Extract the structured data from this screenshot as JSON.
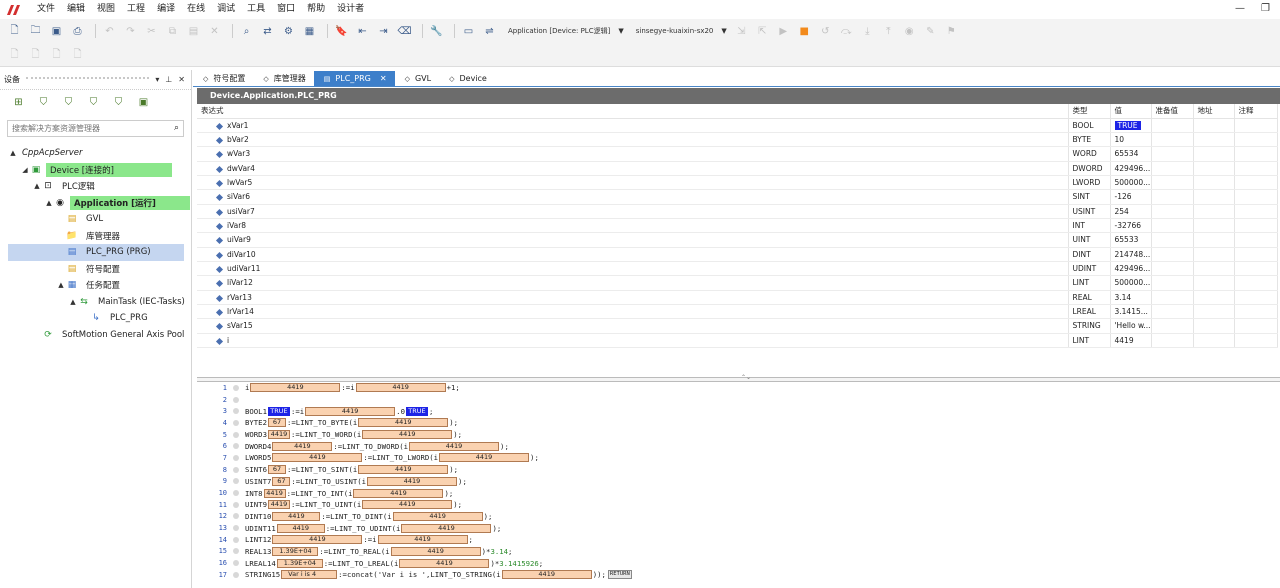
{
  "menu": [
    "文件",
    "编辑",
    "视图",
    "工程",
    "编译",
    "在线",
    "调试",
    "工具",
    "窗口",
    "帮助",
    "设计者"
  ],
  "toolbar": {
    "application_dropdown": "Application [Device: PLC逻辑]",
    "device_dropdown": "sinsegye-kuaixin-sx20"
  },
  "side_panel": {
    "title": "设备",
    "search_placeholder": "搜索解决方案资源管理器",
    "tree": [
      {
        "label": "CppAcpServer",
        "level": 0,
        "icon": "project-icon",
        "expander": "▲"
      },
      {
        "label": "Device [连接的]",
        "level": 1,
        "icon": "device-icon",
        "expander": "◢",
        "highlight": "green"
      },
      {
        "label": "PLC逻辑",
        "level": 2,
        "icon": "plc-logic-icon",
        "expander": "▲"
      },
      {
        "label": "Application [运行]",
        "level": 3,
        "icon": "application-icon",
        "expander": "▲",
        "highlight": "green",
        "bold": true
      },
      {
        "label": "GVL",
        "level": 4,
        "icon": "gvl-icon",
        "expander": ""
      },
      {
        "label": "库管理器",
        "level": 4,
        "icon": "library-icon",
        "expander": ""
      },
      {
        "label": "PLC_PRG (PRG)",
        "level": 4,
        "icon": "program-icon",
        "expander": "",
        "selected": true
      },
      {
        "label": "符号配置",
        "level": 4,
        "icon": "symbol-config-icon",
        "expander": ""
      },
      {
        "label": "任务配置",
        "level": 4,
        "icon": "task-config-icon",
        "expander": "▲"
      },
      {
        "label": "MainTask (IEC-Tasks)",
        "level": 5,
        "icon": "task-icon",
        "expander": "▲"
      },
      {
        "label": "PLC_PRG",
        "level": 6,
        "icon": "call-icon",
        "expander": ""
      },
      {
        "label": "SoftMotion General Axis Pool",
        "level": 2,
        "icon": "axis-pool-icon",
        "expander": ""
      }
    ]
  },
  "tabs": [
    {
      "label": "符号配置",
      "active": false
    },
    {
      "label": "库管理器",
      "active": false
    },
    {
      "label": "PLC_PRG",
      "active": true
    },
    {
      "label": "GVL",
      "active": false
    },
    {
      "label": "Device",
      "active": false
    }
  ],
  "watch": {
    "title": "Device.Application.PLC_PRG",
    "headers": [
      "表达式",
      "类型",
      "值",
      "准备值",
      "地址",
      "注释"
    ],
    "rows": [
      {
        "expr": "xVar1",
        "type": "BOOL",
        "value": "TRUE",
        "bool": true
      },
      {
        "expr": "bVar2",
        "type": "BYTE",
        "value": "10"
      },
      {
        "expr": "wVar3",
        "type": "WORD",
        "value": "65534"
      },
      {
        "expr": "dwVar4",
        "type": "DWORD",
        "value": "429496..."
      },
      {
        "expr": "lwVar5",
        "type": "LWORD",
        "value": "500000..."
      },
      {
        "expr": "siVar6",
        "type": "SINT",
        "value": "-126"
      },
      {
        "expr": "usiVar7",
        "type": "USINT",
        "value": "254"
      },
      {
        "expr": "iVar8",
        "type": "INT",
        "value": "-32766"
      },
      {
        "expr": "uiVar9",
        "type": "UINT",
        "value": "65533"
      },
      {
        "expr": "diVar10",
        "type": "DINT",
        "value": "214748..."
      },
      {
        "expr": "udiVar11",
        "type": "UDINT",
        "value": "429496..."
      },
      {
        "expr": "liVar12",
        "type": "LINT",
        "value": "500000..."
      },
      {
        "expr": "rVar13",
        "type": "REAL",
        "value": "3.14"
      },
      {
        "expr": "lrVar14",
        "type": "LREAL",
        "value": "3.1415..."
      },
      {
        "expr": "sVar15",
        "type": "STRING",
        "value": "'Hello w..."
      },
      {
        "expr": "i",
        "type": "LINT",
        "value": "4419"
      }
    ]
  },
  "code": {
    "lines": [
      {
        "n": "1",
        "segs": [
          [
            "t",
            "i"
          ],
          [
            "m",
            "4419",
            90
          ],
          [
            "t",
            ":=i"
          ],
          [
            "m",
            "4419",
            90
          ],
          [
            "t",
            "+1;"
          ]
        ]
      },
      {
        "n": "2",
        "segs": []
      },
      {
        "n": "3",
        "segs": [
          [
            "t",
            "BOOL1"
          ],
          [
            "b",
            "TRUE"
          ],
          [
            "t",
            ":=i"
          ],
          [
            "m",
            "4419",
            90
          ],
          [
            "t",
            "."
          ],
          [
            "t",
            "0"
          ],
          [
            "b",
            "TRUE"
          ],
          [
            "t",
            ";"
          ]
        ]
      },
      {
        "n": "4",
        "segs": [
          [
            "t",
            "BYTE2"
          ],
          [
            "m",
            "67",
            18
          ],
          [
            "t",
            ":=LINT_TO_BYTE(i"
          ],
          [
            "m",
            "4419",
            90
          ],
          [
            "t",
            ");"
          ]
        ]
      },
      {
        "n": "5",
        "segs": [
          [
            "t",
            "WORD3"
          ],
          [
            "m",
            "4419",
            22
          ],
          [
            "t",
            ":=LINT_TO_WORD(i"
          ],
          [
            "m",
            "4419",
            90
          ],
          [
            "t",
            ");"
          ]
        ]
      },
      {
        "n": "6",
        "segs": [
          [
            "t",
            "DWORD4"
          ],
          [
            "m",
            "4419",
            60
          ],
          [
            "t",
            ":=LINT_TO_DWORD(i"
          ],
          [
            "m",
            "4419",
            90
          ],
          [
            "t",
            ");"
          ]
        ]
      },
      {
        "n": "7",
        "segs": [
          [
            "t",
            "LWORD5"
          ],
          [
            "m",
            "4419",
            90
          ],
          [
            "t",
            ":=LINT_TO_LWORD(i"
          ],
          [
            "m",
            "4419",
            90
          ],
          [
            "t",
            ");"
          ]
        ]
      },
      {
        "n": "8",
        "segs": [
          [
            "t",
            "SINT6"
          ],
          [
            "m",
            "67",
            18
          ],
          [
            "t",
            ":=LINT_TO_SINT(i"
          ],
          [
            "m",
            "4419",
            90
          ],
          [
            "t",
            ");"
          ]
        ]
      },
      {
        "n": "9",
        "segs": [
          [
            "t",
            "USINT7"
          ],
          [
            "m",
            "67",
            18
          ],
          [
            "t",
            ":=LINT_TO_USINT(i"
          ],
          [
            "m",
            "4419",
            90
          ],
          [
            "t",
            ");"
          ]
        ]
      },
      {
        "n": "10",
        "segs": [
          [
            "t",
            "INT8"
          ],
          [
            "m",
            "4419",
            22
          ],
          [
            "t",
            ":=LINT_TO_INT(i"
          ],
          [
            "m",
            "4419",
            90
          ],
          [
            "t",
            ");"
          ]
        ]
      },
      {
        "n": "11",
        "segs": [
          [
            "t",
            "UINT9"
          ],
          [
            "m",
            "4419",
            22
          ],
          [
            "t",
            ":=LINT_TO_UINT(i"
          ],
          [
            "m",
            "4419",
            90
          ],
          [
            "t",
            ");"
          ]
        ]
      },
      {
        "n": "12",
        "segs": [
          [
            "t",
            "DINT10"
          ],
          [
            "m",
            "4419",
            48
          ],
          [
            "t",
            ":=LINT_TO_DINT(i"
          ],
          [
            "m",
            "4419",
            90
          ],
          [
            "t",
            ");"
          ]
        ]
      },
      {
        "n": "13",
        "segs": [
          [
            "t",
            "UDINT11"
          ],
          [
            "m",
            "4419",
            48
          ],
          [
            "t",
            ":=LINT_TO_UDINT(i"
          ],
          [
            "m",
            "4419",
            90
          ],
          [
            "t",
            ");"
          ]
        ]
      },
      {
        "n": "14",
        "segs": [
          [
            "t",
            "LINT12"
          ],
          [
            "m",
            "4419",
            90
          ],
          [
            "t",
            ":=i"
          ],
          [
            "m",
            "4419",
            90
          ],
          [
            "t",
            ";"
          ]
        ]
      },
      {
        "n": "15",
        "segs": [
          [
            "t",
            "REAL13"
          ],
          [
            "a",
            "1.39E+04",
            46
          ],
          [
            "t",
            ":=LINT_TO_REAL(i"
          ],
          [
            "m",
            "4419",
            90
          ],
          [
            "t",
            ")*"
          ],
          [
            "g",
            "3.14"
          ],
          [
            "t",
            ";"
          ]
        ]
      },
      {
        "n": "16",
        "segs": [
          [
            "t",
            "LREAL14"
          ],
          [
            "a",
            "1.39E+04",
            46
          ],
          [
            "t",
            ":=LINT_TO_LREAL(i"
          ],
          [
            "m",
            "4419",
            90
          ],
          [
            "t",
            ")*"
          ],
          [
            "g",
            "3.1415926"
          ],
          [
            "t",
            ";"
          ]
        ]
      },
      {
        "n": "17",
        "segs": [
          [
            "t",
            "STRING15"
          ],
          [
            "a",
            "Var i is 4",
            56
          ],
          [
            "t",
            ":=concat('Var i is ',LINT_TO_STRING(i"
          ],
          [
            "m",
            "4419",
            90
          ],
          [
            "t",
            "));"
          ],
          [
            "r",
            "RETURN"
          ]
        ]
      }
    ]
  }
}
